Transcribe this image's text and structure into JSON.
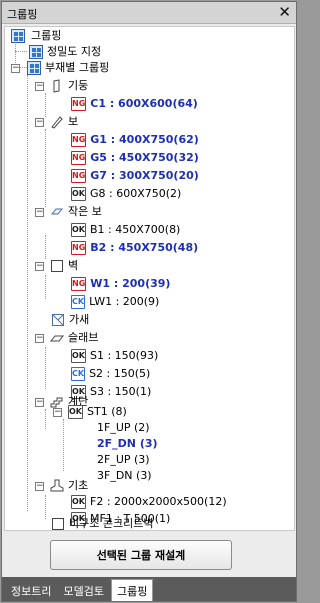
{
  "window": {
    "title": "그룹핑",
    "close": "✕"
  },
  "tree": {
    "root": "그룹핑",
    "precision": "정밀도 지정",
    "by_member": "부재별 그룹핑",
    "column": {
      "label": "기둥",
      "items": [
        {
          "badge": "NG",
          "text": "C1 : 600X600(64)"
        }
      ]
    },
    "beam": {
      "label": "보",
      "items": [
        {
          "badge": "NG",
          "text": "G1 : 400X750(62)"
        },
        {
          "badge": "NG",
          "text": "G5 : 450X750(32)"
        },
        {
          "badge": "NG",
          "text": "G7 : 300X750(20)"
        },
        {
          "badge": "OK",
          "text": "G8 : 600X750(2)"
        }
      ]
    },
    "small_beam": {
      "label": "작은 보",
      "items": [
        {
          "badge": "OK",
          "text": "B1 : 450X700(8)"
        },
        {
          "badge": "NG",
          "text": "B2 : 450X750(48)"
        }
      ]
    },
    "wall": {
      "label": "벽",
      "items": [
        {
          "badge": "NG",
          "text": "W1 : 200(39)"
        },
        {
          "badge": "CK",
          "text": "LW1 : 200(9)"
        }
      ]
    },
    "brace": {
      "label": "가새"
    },
    "slab": {
      "label": "슬래브",
      "items": [
        {
          "badge": "OK",
          "text": "S1 : 150(93)"
        },
        {
          "badge": "CK",
          "text": "S2 : 150(5)"
        },
        {
          "badge": "OK",
          "text": "S3 : 150(1)"
        }
      ]
    },
    "stair": {
      "label": "계단",
      "st": {
        "badge": "OK",
        "text": "ST1 (8)"
      },
      "items": [
        {
          "text": "1F_UP (2)"
        },
        {
          "text": "2F_DN (3)"
        },
        {
          "text": "2F_UP (3)"
        },
        {
          "text": "3F_DN (3)"
        }
      ]
    },
    "footing": {
      "label": "기초",
      "items": [
        {
          "badge": "OK",
          "text": "F2 : 2000x2000x500(12)"
        },
        {
          "badge": "OK",
          "text": "MF1 : T 500(1)"
        }
      ]
    },
    "nonstructural": {
      "label": "비구조 콘크리트벽"
    }
  },
  "button": {
    "reset": "선택된 그룹 재설계"
  },
  "tabs": [
    "정보트리",
    "모델검토",
    "그룹핑"
  ],
  "colors": {
    "highlight_text": "#1d2fb8",
    "ng": "#d21a1a",
    "ck": "#2a6fd1"
  }
}
